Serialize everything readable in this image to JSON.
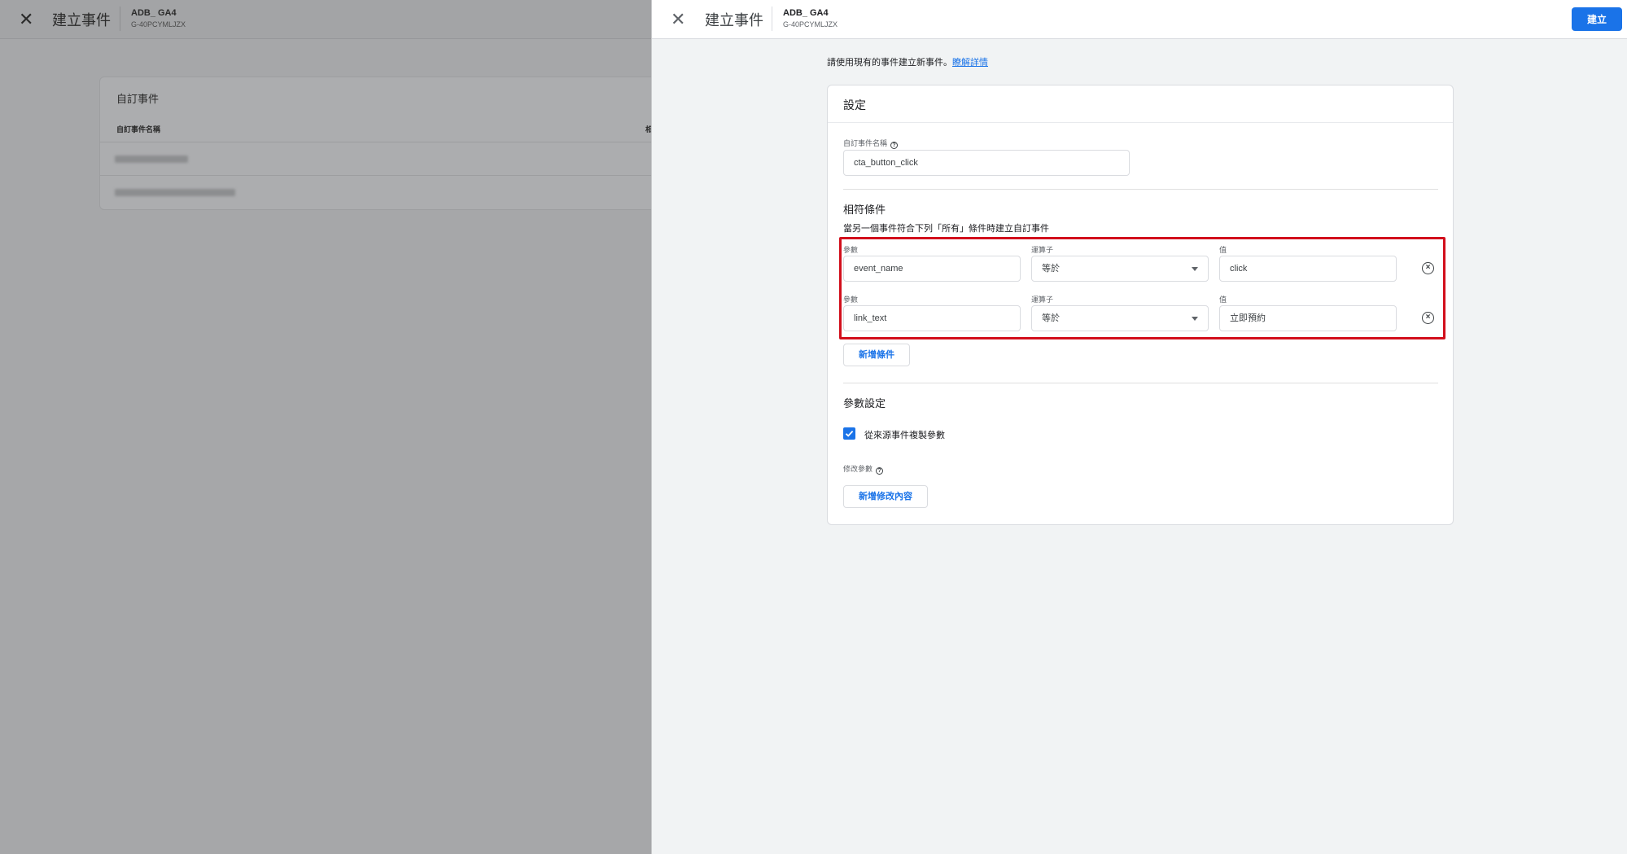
{
  "background_page": {
    "close_symbol": "✕",
    "title": "建立事件",
    "property_name": "ADB_ GA4",
    "property_id": "G-40PCYMLJZX",
    "card_title": "自訂事件",
    "column_header": "自訂事件名稱",
    "column_header_2": "相"
  },
  "panel": {
    "header": {
      "close_symbol": "✕",
      "title": "建立事件",
      "property_name": "ADB_ GA4",
      "property_id": "G-40PCYMLJZX",
      "create_label": "建立"
    },
    "intro_text": "請使用現有的事件建立新事件。",
    "intro_link": "瞭解詳情",
    "settings": {
      "title": "設定",
      "custom_event_name_label": "自訂事件名稱",
      "custom_event_name_value": "cta_button_click",
      "matching_title": "相符條件",
      "matching_desc": "當另一個事件符合下列「所有」條件時建立自訂事件",
      "conditions": [
        {
          "param_label": "參數",
          "param_value": "event_name",
          "operator_label": "運算子",
          "operator_value": "等於",
          "value_label": "值",
          "value": "click"
        },
        {
          "param_label": "參數",
          "param_value": "link_text",
          "operator_label": "運算子",
          "operator_value": "等於",
          "value_label": "值",
          "value": "立即預約"
        }
      ],
      "add_condition_label": "新增條件",
      "param_settings_title": "參數設定",
      "copy_params_label": "從來源事件複製參數",
      "copy_params_checked": true,
      "modify_params_label": "修改參數",
      "add_modification_label": "新增修改內容"
    }
  },
  "colors": {
    "accent": "#1a73e8",
    "highlight_border": "#d20f1c",
    "overlay": "#a6a7a9"
  }
}
